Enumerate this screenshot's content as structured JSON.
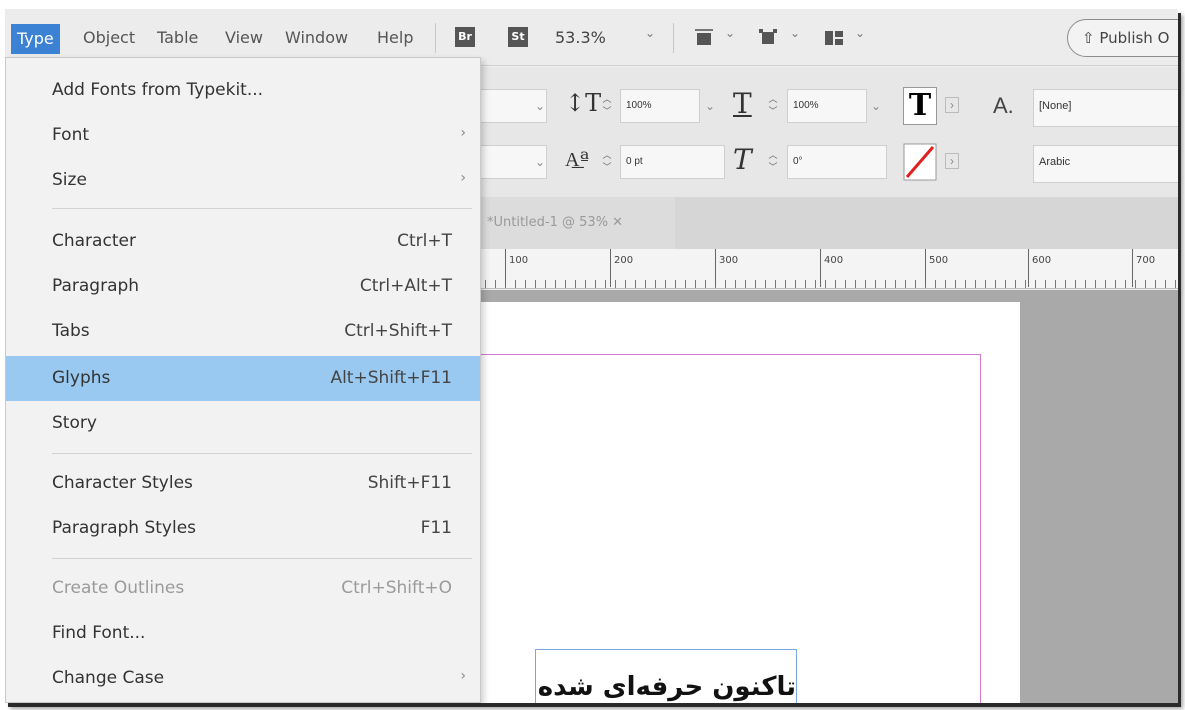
{
  "menubar": {
    "items": [
      "Type",
      "Object",
      "Table",
      "View",
      "Window",
      "Help"
    ],
    "bridge_badge": "Br",
    "stock_badge": "St",
    "zoom": "53.3%",
    "publish_label": "Publish O"
  },
  "control_panel": {
    "vertical_scale": "100%",
    "horizontal_scale": "100%",
    "baseline_shift": "0 pt",
    "skew": "0°",
    "char_style": "[None]",
    "language": "Arabic",
    "char_style_icon_label": "A."
  },
  "document": {
    "tab_title": "*Untitled-1 @ 53% ✕",
    "ruler_labels": [
      "100",
      "200",
      "300",
      "400",
      "500",
      "600",
      "700"
    ],
    "text_content": "تاکنون حرفه‌ای شده"
  },
  "type_menu": {
    "items": [
      {
        "label": "Add Fonts from Typekit...",
        "shortcut": "",
        "submenu": false
      },
      {
        "label": "Font",
        "shortcut": "",
        "submenu": true
      },
      {
        "label": "Size",
        "shortcut": "",
        "submenu": true
      },
      {
        "label": "Character",
        "shortcut": "Ctrl+T",
        "submenu": false
      },
      {
        "label": "Paragraph",
        "shortcut": "Ctrl+Alt+T",
        "submenu": false
      },
      {
        "label": "Tabs",
        "shortcut": "Ctrl+Shift+T",
        "submenu": false
      },
      {
        "label": "Glyphs",
        "shortcut": "Alt+Shift+F11",
        "submenu": false,
        "highlighted": true
      },
      {
        "label": "Story",
        "shortcut": "",
        "submenu": false
      },
      {
        "label": "Character Styles",
        "shortcut": "Shift+F11",
        "submenu": false
      },
      {
        "label": "Paragraph Styles",
        "shortcut": "F11",
        "submenu": false
      },
      {
        "label": "Create Outlines",
        "shortcut": "Ctrl+Shift+O",
        "submenu": false,
        "disabled": true
      },
      {
        "label": "Find Font...",
        "shortcut": "",
        "submenu": false
      },
      {
        "label": "Change Case",
        "shortcut": "",
        "submenu": true
      }
    ],
    "submenu_glyph": "›"
  },
  "colors": {
    "active_menu": "#3b82d4",
    "highlight_item": "#99c9f0",
    "margin_guide": "#d67ad6",
    "frame_edge": "#7aa7e0"
  }
}
